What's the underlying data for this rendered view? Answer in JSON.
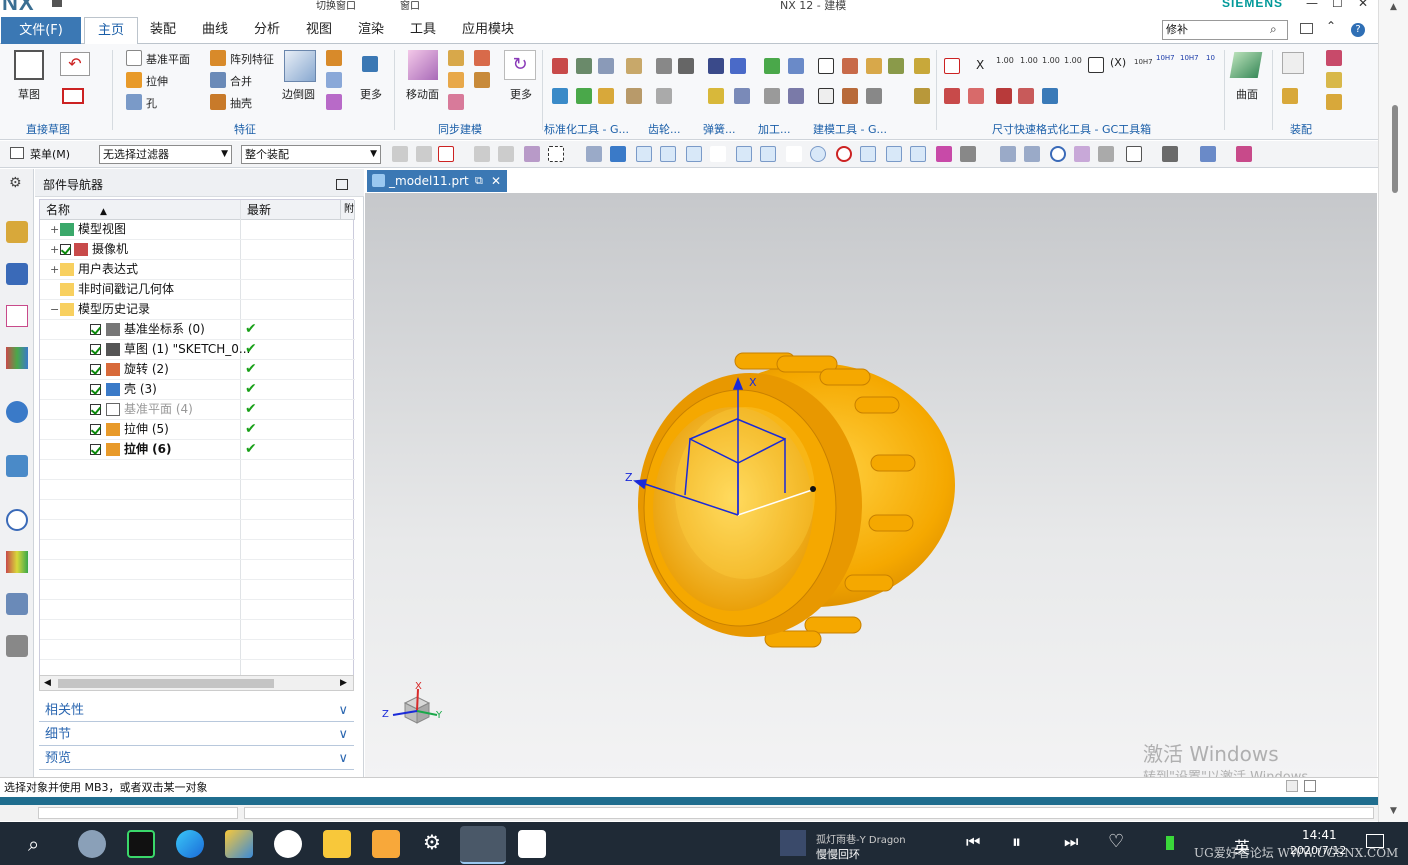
{
  "window": {
    "app_logo": "NX",
    "title": "NX 12 - 建模",
    "brand": "SIEMENS",
    "quick_switch": "切换窗口",
    "quick_window": "窗口"
  },
  "ribbon_tabs": [
    "文件(F)",
    "主页",
    "装配",
    "曲线",
    "分析",
    "视图",
    "渲染",
    "工具",
    "应用模块"
  ],
  "command_finder": "修补",
  "ribbon": {
    "sketch": "草图",
    "groups": [
      "直接草图",
      "特征",
      "同步建模",
      "标准化工具 - G...",
      "齿轮...",
      "弹簧...",
      "加工...",
      "建模工具 - G...",
      "尺寸快速格式化工具 - GC工具箱",
      "装配"
    ],
    "feature_items": [
      "基准平面",
      "阵列特征",
      "拉伸",
      "合并",
      "孔",
      "抽壳",
      "边倒圆",
      "更多"
    ],
    "sync_items": [
      "移动面",
      "更多"
    ],
    "dim_items": [
      "1.00",
      "1.00",
      "1.00",
      "1.00",
      "10H7",
      "10H7",
      "10H7",
      "10"
    ],
    "surface": "曲面"
  },
  "toolbar2": {
    "menu": "菜单(M)",
    "filter": "无选择过滤器",
    "scope": "整个装配"
  },
  "navigator": {
    "title": "部件导航器",
    "col_name": "名称",
    "col_latest": "最新",
    "col_extra": "附",
    "rows": [
      {
        "label": "模型视图",
        "latest": ""
      },
      {
        "label": "摄像机",
        "latest": ""
      },
      {
        "label": "用户表达式",
        "latest": ""
      },
      {
        "label": "非时间戳记几何体",
        "latest": ""
      },
      {
        "label": "模型历史记录",
        "latest": ""
      },
      {
        "label": "基准坐标系 (0)",
        "latest": "✔"
      },
      {
        "label": "草图 (1) \"SKETCH_0...",
        "latest": "✔"
      },
      {
        "label": "旋转 (2)",
        "latest": "✔"
      },
      {
        "label": "壳 (3)",
        "latest": "✔"
      },
      {
        "label": "基准平面 (4)",
        "latest": "✔"
      },
      {
        "label": "拉伸 (5)",
        "latest": "✔"
      },
      {
        "label": "拉伸 (6)",
        "latest": "✔"
      }
    ],
    "panels": [
      "相关性",
      "细节",
      "预览"
    ]
  },
  "viewport": {
    "tab": "_model11.prt",
    "axis_x": "X",
    "axis_z": "Z",
    "triad_x": "X",
    "triad_y": "Y",
    "triad_z": "Z",
    "activate_1": "激活 Windows",
    "activate_2": "转到\"设置\"以激活 Windows。"
  },
  "status_bar": "选择对象并使用 MB3，或者双击某一对象",
  "taskbar": {
    "song": "孤灯雨巷-Y Dragon",
    "song2": "慢慢回环",
    "ime": "英",
    "time": "14:41",
    "date": "2020/7/12",
    "forum": "UG爱好者论坛 WWW.UGSNX.COM"
  }
}
